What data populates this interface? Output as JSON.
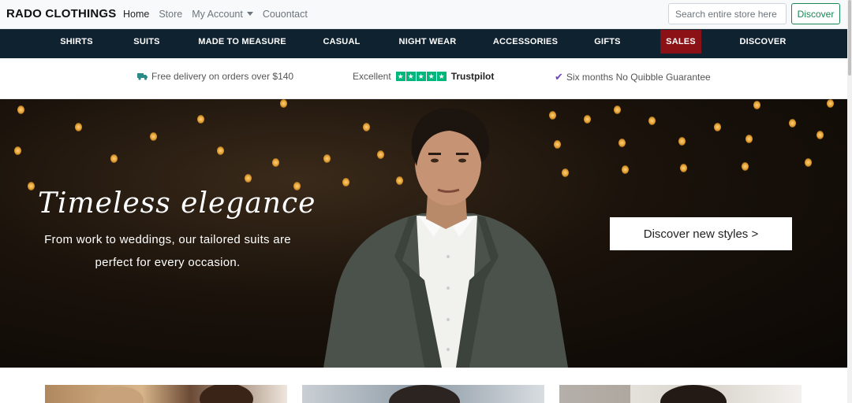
{
  "brand": "RADO CLOTHINGS",
  "topnav": {
    "home": "Home",
    "store": "Store",
    "account": "My Account",
    "contact": "Couontact"
  },
  "search": {
    "placeholder": "Search entire store here"
  },
  "discover_button": "Discover",
  "categories": [
    "SHIRTS",
    "SUITS",
    "MADE TO MEASURE",
    "CASUAL",
    "NIGHT WEAR",
    "ACCESSORIES",
    "GIFTS",
    "SALES",
    "DISCOVER"
  ],
  "info": {
    "delivery": "Free delivery on orders over $140",
    "rating_label": "Excellent",
    "trustpilot": "Trustpilot",
    "guarantee": "Six months No Quibble Guarantee"
  },
  "hero": {
    "title": "Timeless elegance",
    "subtitle": "From work to weddings, our tailored suits are perfect for every occasion.",
    "cta": "Discover new styles >"
  },
  "colors": {
    "nav_bg": "#0f2230",
    "sales_bg": "#8b1117",
    "discover_green": "#198754",
    "trustpilot_green": "#00b67a"
  }
}
